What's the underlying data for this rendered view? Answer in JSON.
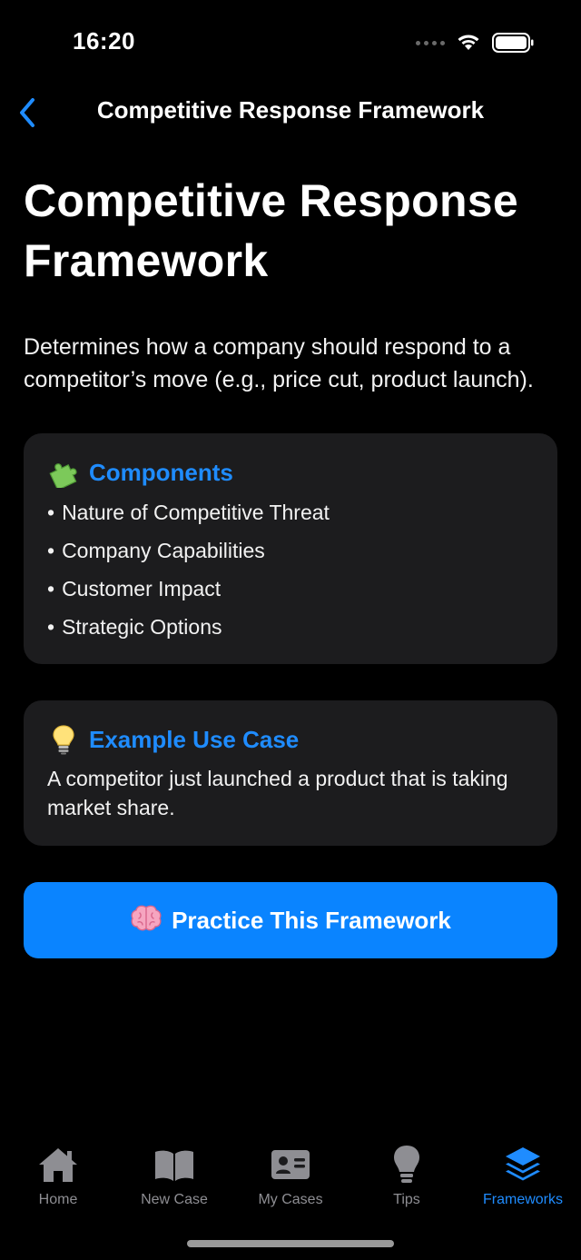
{
  "status_bar": {
    "time": "16:20"
  },
  "nav": {
    "title": "Competitive Response Framework",
    "back_icon": "chevron-left-icon"
  },
  "page": {
    "title": "Competitive Response Framework",
    "description": "Determines how a company should respond to a competitor’s move (e.g., price cut, product launch)."
  },
  "components": {
    "icon": "puzzle-piece-icon",
    "title": "Components",
    "bullet": "•",
    "items": [
      "Nature of Competitive Threat",
      "Company Capabilities",
      "Customer Impact",
      "Strategic Options"
    ]
  },
  "example": {
    "icon": "light-bulb-icon",
    "title": "Example Use Case",
    "text": "A competitor just launched a product that is taking market share."
  },
  "practice_button": {
    "icon": "brain-icon",
    "label": "Practice This Framework"
  },
  "tabs": [
    {
      "label": "Home",
      "icon": "house-icon",
      "active": false
    },
    {
      "label": "New Case",
      "icon": "book-icon",
      "active": false
    },
    {
      "label": "My Cases",
      "icon": "id-card-icon",
      "active": false
    },
    {
      "label": "Tips",
      "icon": "light-bulb-icon",
      "active": false
    },
    {
      "label": "Frameworks",
      "icon": "layers-icon",
      "active": true
    }
  ],
  "colors": {
    "background": "#000000",
    "card": "#1c1c1e",
    "accent": "#0a84ff",
    "tab_inactive": "#8e8e93"
  }
}
